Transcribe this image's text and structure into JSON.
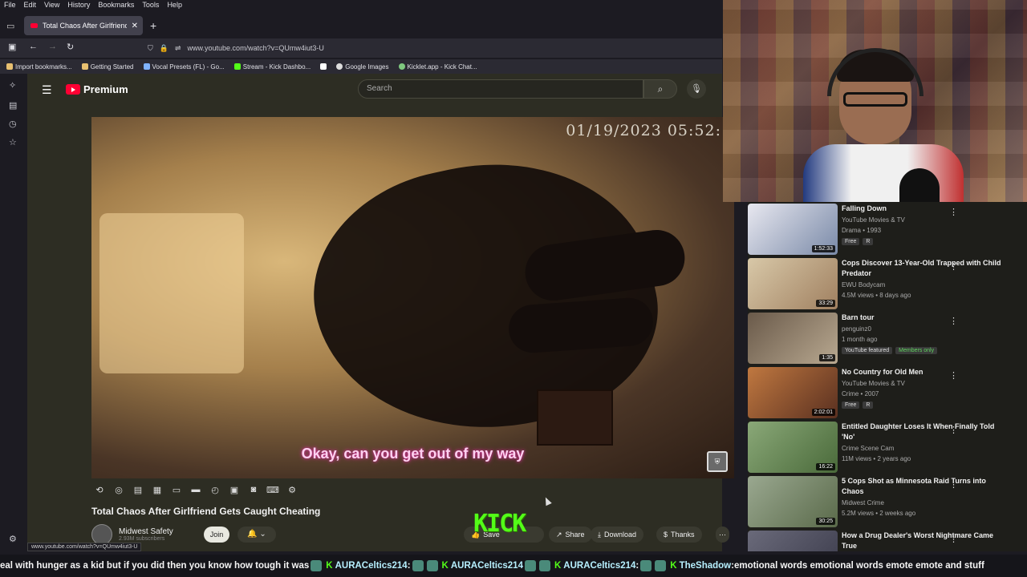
{
  "menu": [
    "File",
    "Edit",
    "View",
    "History",
    "Bookmarks",
    "Tools",
    "Help"
  ],
  "tab": {
    "title": "Total Chaos After Girlfriend"
  },
  "url": "www.youtube.com/watch?v=QUmw4iut3-U",
  "bookmarks": [
    {
      "label": "Import bookmarks...",
      "color": "#e8c070"
    },
    {
      "label": "Getting Started",
      "color": "#e8c070"
    },
    {
      "label": "Vocal Presets (FL) - Go...",
      "color": "#7fb3ff"
    },
    {
      "label": "Stream - Kick Dashbo...",
      "color": "#53fc18"
    },
    {
      "label": "",
      "color": "#ffffff"
    },
    {
      "label": "Google Images",
      "color": "#dddddd"
    },
    {
      "label": "Kicklet.app - Kick Chat...",
      "color": "#7fc97f"
    }
  ],
  "youtube": {
    "brand": "Premium",
    "search_placeholder": "Search"
  },
  "video": {
    "timestamp": "01/19/2023  05:52:",
    "subtitle": "Okay, can you get out of my way",
    "title": "Total Chaos After Girlfriend Gets Caught Cheating",
    "channel": "Midwest Safety",
    "subs": "2.93M subscribers",
    "join": "Join",
    "actions": {
      "save": "Save",
      "share": "Share",
      "download": "Download",
      "thanks": "Thanks",
      "more": "⋯"
    }
  },
  "kick_logo": "KICK",
  "status_url": "www.youtube.com/watch?v=QUmw4iut3-U",
  "recommendations": [
    {
      "title": "Falling Down",
      "meta1": "YouTube Movies & TV",
      "meta2": "Drama • 1993",
      "duration": "1:52:33",
      "tags": [
        "Free",
        "R"
      ],
      "thumb": "#7a8aa8"
    },
    {
      "title": "Cops Discover 13-Year-Old Trapped with Child Predator",
      "meta1": "EWU Bodycam",
      "meta2": "4.5M views • 8 days ago",
      "duration": "33:29",
      "tags": [],
      "thumb": "#c8b898"
    },
    {
      "title": "Barn tour",
      "meta1": "penguinz0",
      "meta2": "1 month ago",
      "duration": "1:35",
      "tags": [
        "YouTube featured",
        "Members only"
      ],
      "thumb": "#8a7a6a"
    },
    {
      "title": "No Country for Old Men",
      "meta1": "YouTube Movies & TV",
      "meta2": "Crime • 2007",
      "duration": "2:02:01",
      "tags": [
        "Free",
        "R"
      ],
      "thumb": "#a86a40"
    },
    {
      "title": "Entitled Daughter Loses It When Finally Told 'No'",
      "meta1": "Crime Scene Cam",
      "meta2": "11M views • 2 years ago",
      "duration": "16:22",
      "tags": [],
      "thumb": "#6a8a5a"
    },
    {
      "title": "5 Cops Shot as Minnesota Raid Turns into Chaos",
      "meta1": "Midwest Crime",
      "meta2": "5.2M views • 2 weeks ago",
      "duration": "30:25",
      "tags": [],
      "thumb": "#7a8a6a"
    },
    {
      "title": "How a Drug Dealer's Worst Nightmare Came True",
      "meta1": "",
      "meta2": "",
      "duration": "",
      "tags": [],
      "thumb": "#5a5a6a"
    }
  ],
  "ticker": {
    "text1": "eal with hunger as a kid but if you did then you know how tough it was",
    "user1": "AURACeltics214",
    "user2": "AURACeltics214",
    "user3": "AURACeltics214",
    "user4": "TheShadow",
    "text2": "emotional words emotional words emote emote and stuff"
  }
}
